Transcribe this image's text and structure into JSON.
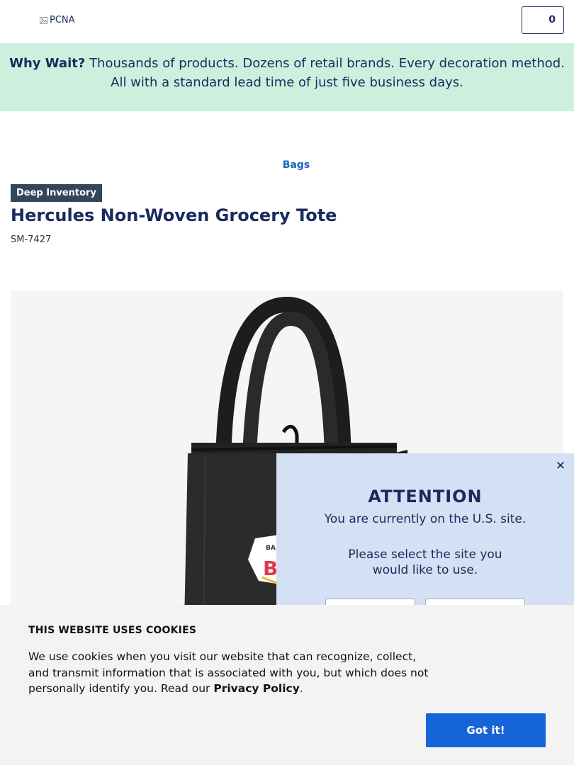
{
  "header": {
    "logo_alt": "PCNA",
    "logo_icon": "broken-image-icon",
    "cart_count": "0"
  },
  "promo": {
    "lead": "Why Wait?",
    "text": " Thousands of products. Dozens of retail brands. Every decoration method. All with a standard lead time of just five business days."
  },
  "breadcrumb": "Bags",
  "product": {
    "badge": "Deep Inventory",
    "title": "Hercules Non-Woven Grocery Tote",
    "sku": "SM-7427"
  },
  "modal": {
    "heading": "ATTENTION",
    "current_site": "You are currently on the U.S. site.",
    "select_message": "Please select the site you would like to use.",
    "close_icon": "close-icon",
    "buttons": [
      "",
      ""
    ]
  },
  "cookie": {
    "title": "THIS WEBSITE USES COOKIES",
    "text": "We use cookies when you visit our website that can recognize, collect, and transmit information that is associated with you, but which does not personally identify you. Read our ",
    "link": "Privacy Policy",
    "end": ".",
    "accept": "Got it!"
  },
  "colors": {
    "brand_navy": "#1a2a5e",
    "promo_bg": "#cdf0de",
    "link_blue": "#1565c0",
    "badge_bg": "#34465a",
    "modal_bg": "#d4e0f3",
    "accept_button": "#1565d8"
  }
}
